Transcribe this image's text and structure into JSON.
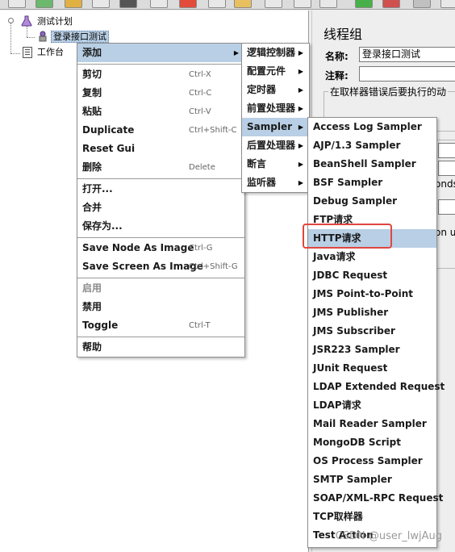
{
  "tree": {
    "root_label": "测试计划",
    "selected_label": "登录接口测试",
    "workbench_label": "工作台"
  },
  "right_panel": {
    "title": "线程组",
    "name_label": "名称:",
    "name_value": "登录接口测试",
    "comment_label": "注释:",
    "group_text": "在取样器错误后要执行的动",
    "partial_text1": "onds",
    "partial_text2": "on u"
  },
  "context_menu": {
    "items": [
      {
        "label": "添加"
      },
      {
        "label": "剪切",
        "shortcut": "Ctrl-X"
      },
      {
        "label": "复制",
        "shortcut": "Ctrl-C"
      },
      {
        "label": "粘贴",
        "shortcut": "Ctrl-V"
      },
      {
        "label": "Duplicate",
        "shortcut": "Ctrl+Shift-C"
      },
      {
        "label": "Reset Gui"
      },
      {
        "label": "删除",
        "shortcut": "Delete"
      },
      {
        "label": "打开..."
      },
      {
        "label": "合并"
      },
      {
        "label": "保存为..."
      },
      {
        "label": "Save Node As Image",
        "shortcut": "Ctrl-G"
      },
      {
        "label": "Save Screen As Image",
        "shortcut": "Ctrl+Shift-G"
      },
      {
        "label": "启用"
      },
      {
        "label": "禁用"
      },
      {
        "label": "Toggle",
        "shortcut": "Ctrl-T"
      },
      {
        "label": "帮助"
      }
    ]
  },
  "add_submenu": {
    "items": [
      {
        "label": "逻辑控制器"
      },
      {
        "label": "配置元件"
      },
      {
        "label": "定时器"
      },
      {
        "label": "前置处理器"
      },
      {
        "label": "Sampler"
      },
      {
        "label": "后置处理器"
      },
      {
        "label": "断言"
      },
      {
        "label": "监听器"
      }
    ]
  },
  "sampler_submenu": {
    "items": [
      {
        "label": "Access Log Sampler"
      },
      {
        "label": "AJP/1.3 Sampler"
      },
      {
        "label": "BeanShell Sampler"
      },
      {
        "label": "BSF Sampler"
      },
      {
        "label": "Debug Sampler"
      },
      {
        "label": "FTP请求"
      },
      {
        "label": "HTTP请求"
      },
      {
        "label": "Java请求"
      },
      {
        "label": "JDBC Request"
      },
      {
        "label": "JMS Point-to-Point"
      },
      {
        "label": "JMS Publisher"
      },
      {
        "label": "JMS Subscriber"
      },
      {
        "label": "JSR223 Sampler"
      },
      {
        "label": "JUnit Request"
      },
      {
        "label": "LDAP Extended Request"
      },
      {
        "label": "LDAP请求"
      },
      {
        "label": "Mail Reader Sampler"
      },
      {
        "label": "MongoDB Script"
      },
      {
        "label": "OS Process Sampler"
      },
      {
        "label": "SMTP Sampler"
      },
      {
        "label": "SOAP/XML-RPC Request"
      },
      {
        "label": "TCP取样器"
      },
      {
        "label": "Test Action"
      }
    ]
  },
  "watermark": "CSDN @user_lwjAug",
  "colors": {
    "menu_highlight": "#b8cfe5",
    "callout_border": "#e0463f"
  }
}
